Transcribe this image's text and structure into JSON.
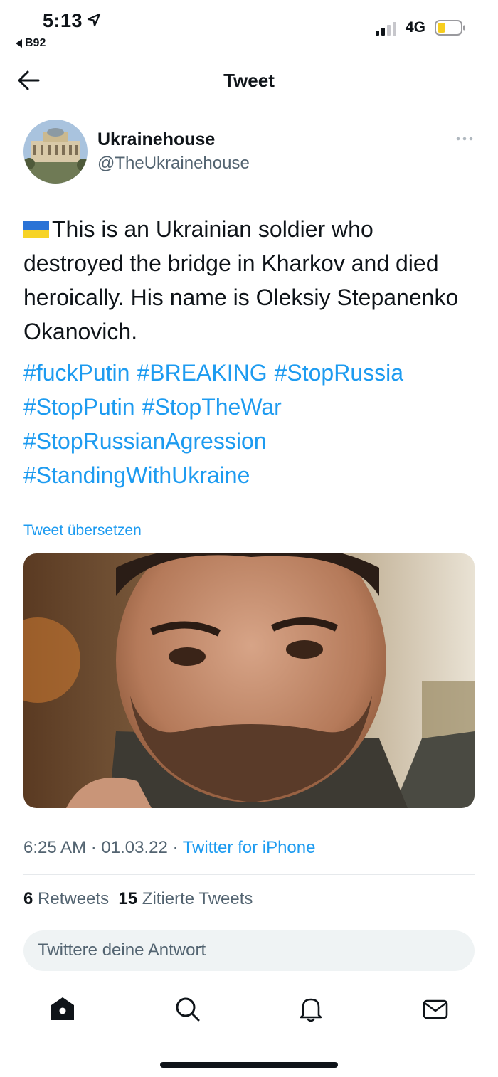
{
  "status_bar": {
    "time": "5:13",
    "back_app": "B92",
    "network": "4G",
    "icons": [
      "location-arrow-icon",
      "signal-icon",
      "battery-icon"
    ]
  },
  "header": {
    "title": "Tweet",
    "back_icon": "arrow-left-icon"
  },
  "author": {
    "name": "Ukrainehouse",
    "handle": "@TheUkrainehouse"
  },
  "tweet": {
    "text": "This is an Ukrainian soldier who destroyed the bridge in Kharkov and died heroically. His name is Oleksiy Stepanenko Okanovich.",
    "hashtags": [
      "#fuckPutin",
      "#BREAKING",
      "#StopRussia",
      "#StopPutin",
      "#StopTheWar",
      "#StopRussianAgression",
      "#StandingWithUkraine"
    ],
    "translate_label": "Tweet übersetzen"
  },
  "meta": {
    "time": "6:25 AM",
    "date": "01.03.22",
    "separator": " · ",
    "source": "Twitter for iPhone"
  },
  "stats": {
    "retweets_count": "6",
    "retweets_label": "Retweets",
    "quotes_count": "15",
    "quotes_label": "Zitierte Tweets"
  },
  "reply": {
    "placeholder": "Twittere deine Antwort"
  },
  "tabbar": {
    "items": [
      "home-icon",
      "search-icon",
      "notifications-icon",
      "messages-icon"
    ]
  },
  "colors": {
    "link": "#1d9bf0",
    "text": "#0f1419",
    "secondary": "#536471",
    "flag_blue": "#2a73d6",
    "flag_yellow": "#f7d326"
  }
}
